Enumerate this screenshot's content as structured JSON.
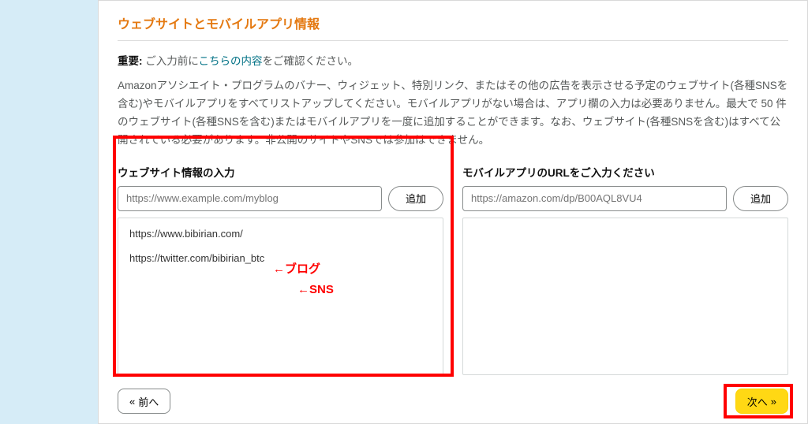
{
  "title": "ウェブサイトとモバイルアプリ情報",
  "important": {
    "prefix": "重要:",
    "before": "ご入力前に",
    "link": "こちらの内容",
    "after": "をご確認ください。"
  },
  "description": "Amazonアソシエイト・プログラムのバナー、ウィジェット、特別リンク、またはその他の広告を表示させる予定のウェブサイト(各種SNSを含む)やモバイルアプリをすべてリストアップしてください。モバイルアプリがない場合は、アプリ欄の入力は必要ありません。最大で 50 件のウェブサイト(各種SNSを含む)またはモバイルアプリを一度に追加することができます。なお、ウェブサイト(各種SNSを含む)はすべて公開されている必要があります。非公開のサイトやSNSでは参加はできません。",
  "left": {
    "label": "ウェブサイト情報の入力",
    "placeholder": "https://www.example.com/myblog",
    "add": "追加",
    "items": [
      "https://www.bibirian.com/",
      "https://twitter.com/bibirian_btc"
    ]
  },
  "right": {
    "label": "モバイルアプリのURLをご入力ください",
    "placeholder": "https://amazon.com/dp/B00AQL8VU4",
    "add": "追加"
  },
  "annotations": {
    "blog": "←ブログ",
    "sns": "←SNS"
  },
  "nav": {
    "prev": "前へ",
    "next": "次へ"
  }
}
